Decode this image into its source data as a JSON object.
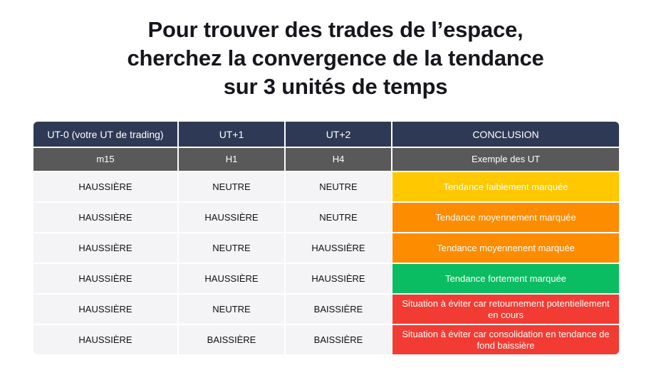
{
  "title": {
    "line1": "Pour trouver des trades de l’espace,",
    "line2": "cherchez la convergence de la tendance",
    "line3": "sur 3 unités de temps"
  },
  "table": {
    "headers": [
      "UT-0 (votre UT de trading)",
      "UT+1",
      "UT+2",
      "CONCLUSION"
    ],
    "subheaders": [
      "m15",
      "H1",
      "H4",
      "Exemple des UT"
    ],
    "rows": [
      {
        "ut0": "HAUSSIÈRE",
        "ut1": "NEUTRE",
        "ut2": "NEUTRE",
        "conclusion": "Tendance faiblement marquée",
        "color": "#ffc800"
      },
      {
        "ut0": "HAUSSIÈRE",
        "ut1": "HAUSSIÈRE",
        "ut2": "NEUTRE",
        "conclusion": "Tendance moyennement marquée",
        "color": "#fd8c00"
      },
      {
        "ut0": "HAUSSIÈRE",
        "ut1": "NEUTRE",
        "ut2": "HAUSSIÈRE",
        "conclusion": "Tendance moyennenent marquée",
        "color": "#fd8c00"
      },
      {
        "ut0": "HAUSSIÈRE",
        "ut1": "HAUSSIÈRE",
        "ut2": "HAUSSIÈRE",
        "conclusion": "Tendance fortement marquée",
        "color": "#0bbd62"
      },
      {
        "ut0": "HAUSSIÈRE",
        "ut1": "NEUTRE",
        "ut2": "BAISSIÈRE",
        "conclusion": "Situation à éviter car retournement potentiellement en cours",
        "color": "#f23c33"
      },
      {
        "ut0": "HAUSSIÈRE",
        "ut1": "BAISSIÈRE",
        "ut2": "BAISSIÈRE",
        "conclusion": "Situation à éviter car consolidation en tendance de fond baissière",
        "color": "#f23c33"
      }
    ]
  },
  "colors": {
    "header": "#2e3a55",
    "subheader": "#595959",
    "row_background": "#f4f4f6"
  }
}
